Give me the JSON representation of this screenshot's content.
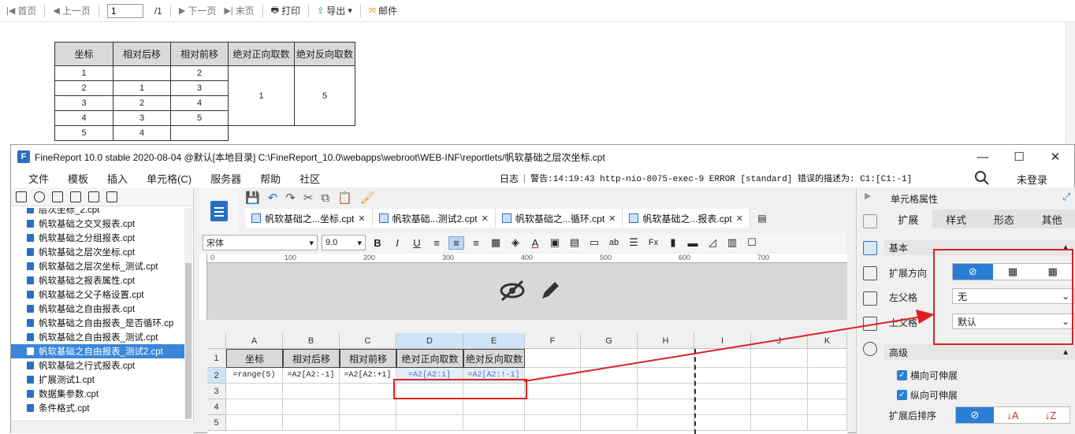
{
  "preview_toolbar": {
    "first": "首页",
    "prev": "上一页",
    "page_value": "1",
    "page_total": "/1",
    "next": "下一页",
    "last": "末页",
    "print": "打印",
    "export": "导出",
    "mail": "邮件"
  },
  "preview_table": {
    "headers": [
      "坐标",
      "相对后移",
      "相对前移",
      "绝对正向取数",
      "绝对反向取数"
    ],
    "rows": [
      [
        "1",
        "",
        "2"
      ],
      [
        "2",
        "1",
        "3"
      ],
      [
        "3",
        "2",
        "4"
      ],
      [
        "4",
        "3",
        "5"
      ],
      [
        "5",
        "4",
        ""
      ]
    ],
    "abs_forward": "1",
    "abs_backward": "5"
  },
  "window": {
    "title": "FineReport 10.0 stable 2020-08-04 @默认[本地目录]    C:\\FineReport_10.0\\webapps\\webroot\\WEB-INF\\reportlets/帆软基础之层次坐标.cpt",
    "logo": "F"
  },
  "menu": {
    "items": [
      "文件",
      "模板",
      "插入",
      "单元格(C)",
      "服务器",
      "帮助",
      "社区"
    ],
    "log_label": "日志",
    "warning": "警告:14:19:43 http-nio-8075-exec-9 ERROR [standard] 错误的描述为: C1:[C1:-1]",
    "login": "未登录"
  },
  "file_list": [
    "层次坐标_2.cpt",
    "帆软基础之交叉报表.cpt",
    "帆软基础之分组报表.cpt",
    "帆软基础之层次坐标.cpt",
    "帆软基础之层次坐标_测试.cpt",
    "帆软基础之报表属性.cpt",
    "帆软基础之父子格设置.cpt",
    "帆软基础之自由报表.cpt",
    "帆软基础之自由报表_是否循环.cp",
    "帆软基础之自由报表_测试.cpt",
    "帆软基础之自由报表_测试2.cpt",
    "帆软基础之行式报表.cpt",
    "扩展测试1.cpt",
    "数据集参数.cpt",
    "条件格式.cpt"
  ],
  "tabs": [
    "帆软基础之...坐标.cpt",
    "帆软基础...测试2.cpt",
    "帆软基础之...循环.cpt",
    "帆软基础之...报表.cpt"
  ],
  "format": {
    "font": "宋体",
    "size": "9.0"
  },
  "ruler": [
    "0",
    "100",
    "200",
    "300",
    "400",
    "500",
    "600",
    "700"
  ],
  "grid": {
    "columns": [
      "A",
      "B",
      "C",
      "D",
      "E",
      "F",
      "G",
      "H",
      "I",
      "J",
      "K"
    ],
    "rows": [
      "1",
      "2",
      "3",
      "4",
      "5"
    ],
    "row1": [
      "坐标",
      "相对后移",
      "相对前移",
      "绝对正向取数",
      "绝对反向取数"
    ],
    "row2": [
      "=range(5)",
      "=A2[A2:-1]",
      "=A2[A2:+1]",
      "=A2[A2:1]",
      "=A2[A2:!-1]"
    ]
  },
  "right_panel": {
    "title": "单元格属性",
    "tabs": [
      "扩展",
      "样式",
      "形态",
      "其他"
    ],
    "basic": "基本",
    "expand_dir": "扩展方向",
    "left_parent": "左父格",
    "left_parent_value": "无",
    "top_parent": "上父格",
    "top_parent_value": "默认",
    "advanced": "高级",
    "h_expand": "横向可伸展",
    "v_expand": "纵向可伸展",
    "sort_after": "扩展后排序"
  },
  "colors": {
    "accent": "#2a7fd4",
    "highlight": "#e02020",
    "selected_row": "#3a86d8"
  }
}
